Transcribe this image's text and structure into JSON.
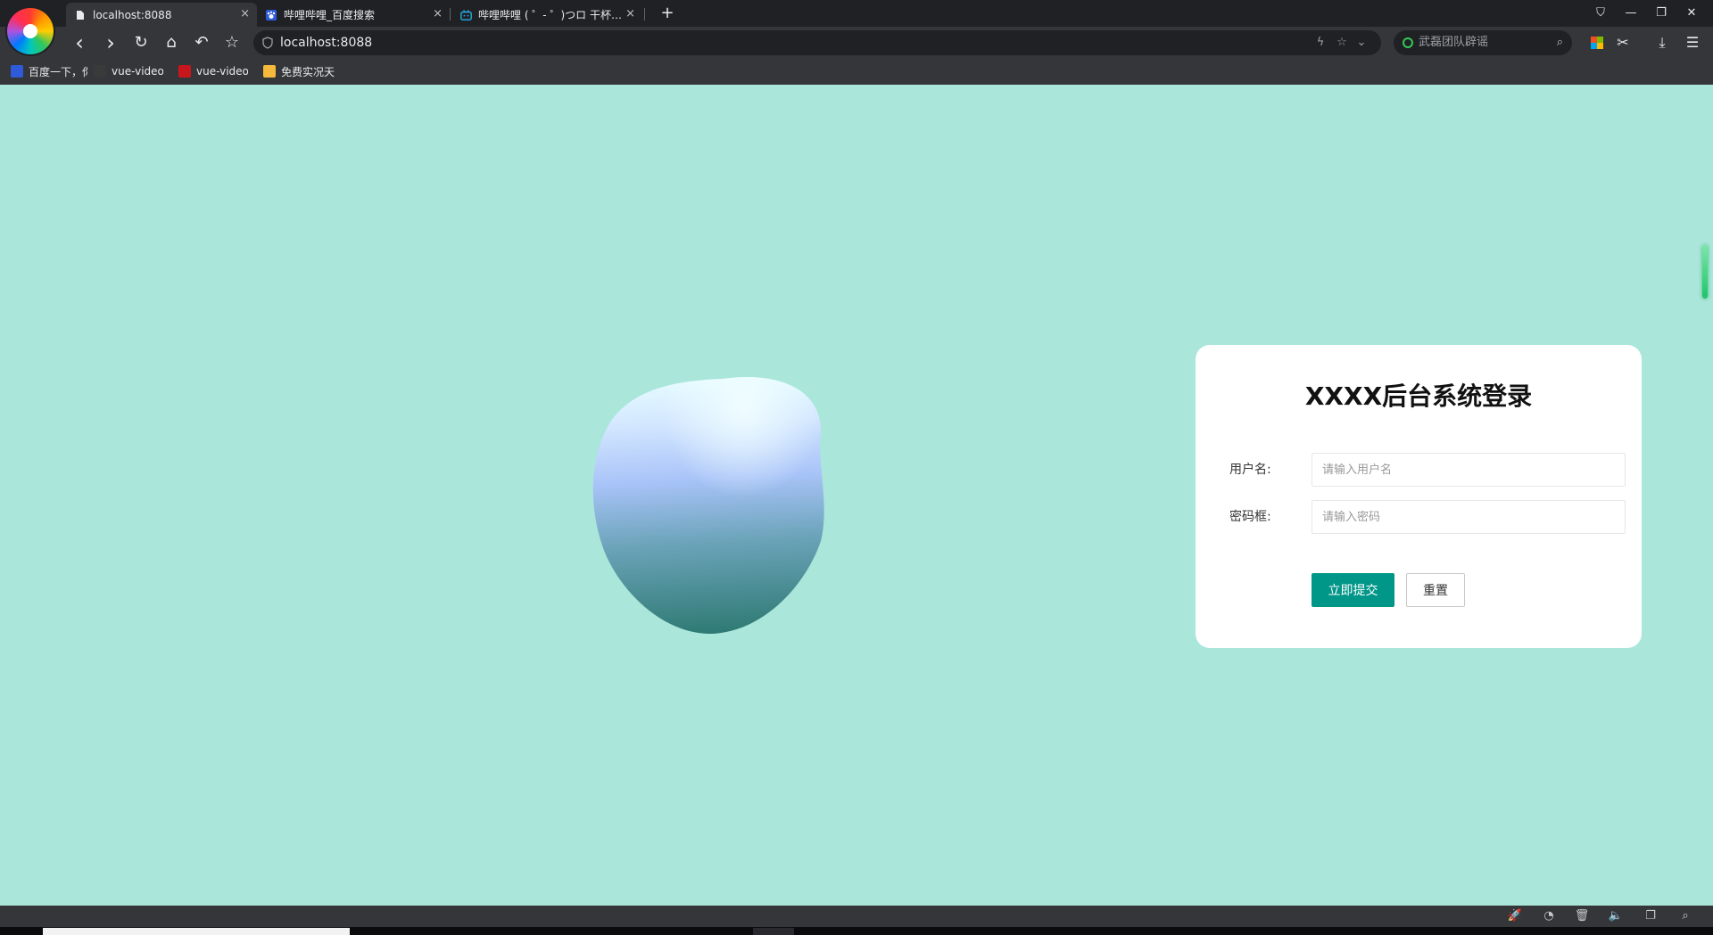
{
  "tabs": [
    {
      "title": "localhost:8088",
      "icon": "document-icon",
      "close": "×"
    },
    {
      "title": "哔哩哔哩_百度搜索",
      "icon": "baidu-paw-icon",
      "close": "×"
    },
    {
      "title": "哔哩哔哩 ( ゜- ゜)つロ 干杯~-bilibili",
      "icon": "bilibili-tv-icon",
      "close": "×"
    }
  ],
  "new_tab": "+",
  "window_controls": {
    "skin": "⛉",
    "minimize": "—",
    "restore": "❐",
    "close": "✕"
  },
  "toolbar": {
    "back": "‹",
    "forward": "›",
    "reload": "↻",
    "home": "⌂",
    "undo_close": "↶",
    "favorite": "☆",
    "address": "localhost:8088",
    "lightning": "ϟ",
    "star": "☆",
    "dropdown": "⌄",
    "search_placeholder": "武磊团队辟谣",
    "search": "⌕",
    "cut": "✂",
    "download": "⤓",
    "menu": "☰"
  },
  "bookmarks": [
    {
      "title": "百度一下，你就知道",
      "color": "#2f5bdb"
    },
    {
      "title": "vue-video-player",
      "color": "#3a3a3a"
    },
    {
      "title": "vue-video-player",
      "color": "#c8161d"
    },
    {
      "title": "免费实况天气",
      "color": "#f5b93b"
    }
  ],
  "login": {
    "title": "XXXX后台系统登录",
    "username_label": "用户名:",
    "username_placeholder": "请输入用户名",
    "password_label": "密码框:",
    "password_placeholder": "请输入密码",
    "submit_label": "立即提交",
    "reset_label": "重置"
  },
  "status_icons": [
    "🚀",
    "◔",
    "🗑",
    "🔈",
    "❐",
    "⌕"
  ],
  "colors": {
    "page_background": "#aae6da",
    "primary_button": "#009688",
    "card_background": "#ffffff"
  }
}
